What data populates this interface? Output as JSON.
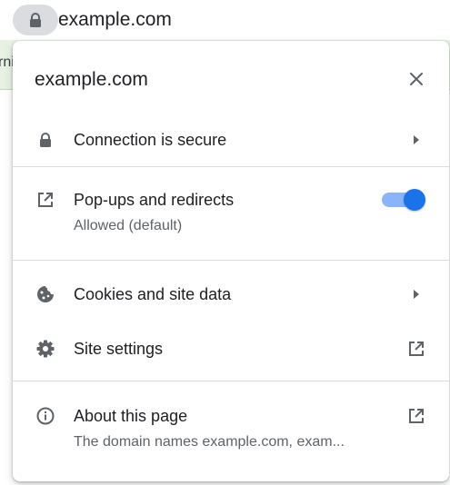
{
  "omnibox": {
    "url": "example.com",
    "lock_icon": "lock-icon"
  },
  "page": {
    "partial_text": "rni"
  },
  "popup": {
    "title": "example.com",
    "close_icon": "close-icon",
    "connection": {
      "label": "Connection is secure",
      "icon": "lock-icon",
      "right_icon": "arrow-right-icon"
    },
    "popups": {
      "label": "Pop-ups and redirects",
      "sublabel": "Allowed (default)",
      "icon": "open-in-new-icon",
      "toggle_on": true,
      "toggle_color": "#1a73e8"
    },
    "cookies": {
      "label": "Cookies and site data",
      "icon": "cookie-icon",
      "right_icon": "arrow-right-icon"
    },
    "site_settings": {
      "label": "Site settings",
      "icon": "gear-icon",
      "right_icon": "launch-icon"
    },
    "about": {
      "label": "About this page",
      "sublabel": "The domain names example.com, exam...",
      "icon": "info-icon",
      "right_icon": "launch-icon"
    }
  }
}
